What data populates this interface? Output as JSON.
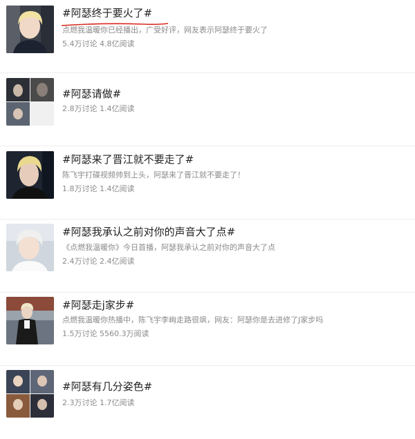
{
  "topics": [
    {
      "title": "#阿瑟终于要火了#",
      "description": "点燃我温暖你已经播出，广受好评，网友表示阿瑟终于要火了",
      "stats": "5.4万讨论 4.8亿阅读",
      "thumbnail": "portrait-blonde-boy"
    },
    {
      "title": "#阿瑟请做#",
      "description": "",
      "stats": "2.8万讨论 1.4亿阅读",
      "thumbnail": "photo-grid-3"
    },
    {
      "title": "#阿瑟来了晋江就不要走了#",
      "description": "陈飞宇打碟视频帅到上头，阿瑟来了晋江就不要走了！",
      "stats": "1.8万讨论 1.4亿阅读",
      "thumbnail": "portrait-blonde-dark"
    },
    {
      "title": "#阿瑟我承认之前对你的声音大了点#",
      "description": "《点燃我温暖你》今日首播，阿瑟我承认之前对你的声音大了点",
      "stats": "2.4万讨论 2.4亿阅读",
      "thumbnail": "portrait-light"
    },
    {
      "title": "#阿瑟走j家步#",
      "description": "点燃我温暖你热播中，陈飞宇李峋走路很飒，网友：阿瑟你是去进修了J家步吗",
      "stats": "1.5万讨论 5560.3万阅读",
      "thumbnail": "portrait-walking"
    },
    {
      "title": "#阿瑟有几分姿色#",
      "description": "",
      "stats": "2.3万讨论 1.7亿阅读",
      "thumbnail": "photo-grid-4"
    }
  ],
  "colors": {
    "underline": "#d9281e",
    "title": "#222222",
    "meta": "#8a8a8a"
  }
}
